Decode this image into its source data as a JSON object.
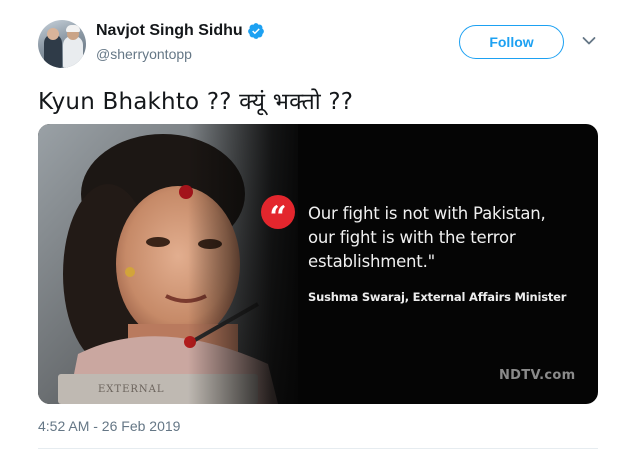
{
  "author": {
    "name": "Navjot Singh Sidhu",
    "handle": "@sherryontopp",
    "verified": true,
    "avatar_icon": "user-avatar"
  },
  "actions": {
    "follow_label": "Follow",
    "more_icon": "chevron-down-icon"
  },
  "tweet": {
    "text": "Kyun Bhakhto ?? क्यूं भक्तो ??",
    "timestamp": "4:52 AM - 26 Feb 2019"
  },
  "media": {
    "quote_mark": "“",
    "quote_line1": "Our fight is not with Pakistan,",
    "quote_line2": "our fight is with the terror",
    "quote_line3": "establishment.\"",
    "attribution": "Sushma Swaraj, External Affairs Minister",
    "watermark": "NDTV.com"
  },
  "colors": {
    "accent": "#1da1f2",
    "quote_badge": "#e3262d",
    "secondary_text": "#657786",
    "media_background": "#050505"
  }
}
